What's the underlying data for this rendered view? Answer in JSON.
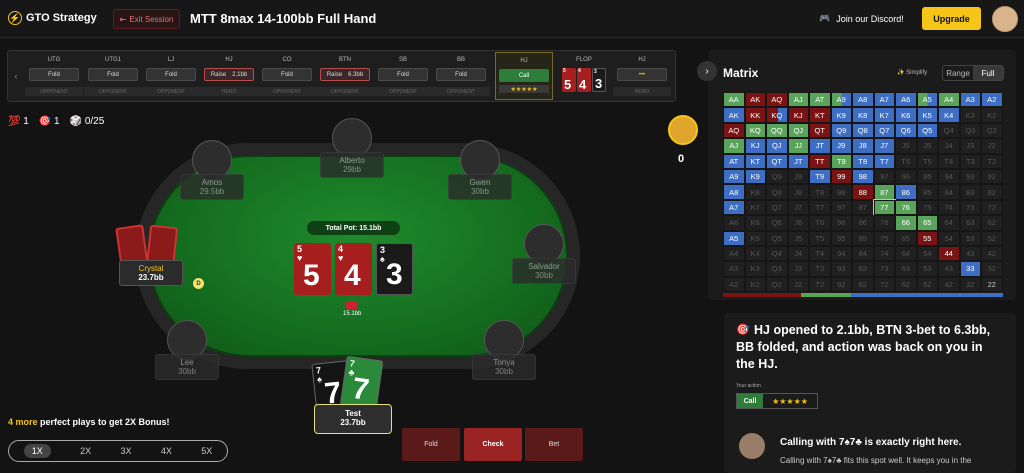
{
  "header": {
    "logo": "GTO Strategy",
    "exit": "Exit Session",
    "title": "MTT 8max 14-100bb Full Hand",
    "discord": "Join our Discord!",
    "upgrade": "Upgrade"
  },
  "strip": [
    {
      "pos": "UTG",
      "act": "Fold",
      "role": "OPPONENT"
    },
    {
      "pos": "UTG1",
      "act": "Fold",
      "role": "OPPONENT"
    },
    {
      "pos": "LJ",
      "act": "Fold",
      "role": "OPPONENT"
    },
    {
      "pos": "HJ",
      "act": "Raise",
      "amt": "2.1bb",
      "role": "HERO"
    },
    {
      "pos": "CO",
      "act": "Fold",
      "role": "OPPONENT"
    },
    {
      "pos": "BTN",
      "act": "Raise",
      "amt": "6.3bb",
      "role": "OPPONENT"
    },
    {
      "pos": "SB",
      "act": "Fold",
      "role": "OPPONENT"
    },
    {
      "pos": "BB",
      "act": "Fold",
      "role": "OPPONENT"
    },
    {
      "pos": "HJ",
      "act": "Call",
      "stars": "★★★★★"
    },
    {
      "pos": "FLOP"
    },
    {
      "pos": "HJ",
      "act": "•••",
      "role": "HERO"
    }
  ],
  "stats": {
    "s1": "💯 1",
    "s2": "🎯 1",
    "s3": "🎲 0/25"
  },
  "coin_value": "0",
  "players": {
    "amos": {
      "name": "Amos",
      "stack": "29.5bb"
    },
    "alberto": {
      "name": "Alberto",
      "stack": "29bb"
    },
    "gwen": {
      "name": "Gwen",
      "stack": "30bb"
    },
    "crystal": {
      "name": "Crystal",
      "stack": "23.7bb"
    },
    "salvador": {
      "name": "Salvador",
      "stack": "30bb"
    },
    "lee": {
      "name": "Lee",
      "stack": "30bb"
    },
    "tonya": {
      "name": "Tonya",
      "stack": "30bb"
    },
    "hero": {
      "name": "Test",
      "stack": "23.7bb"
    }
  },
  "pot": "Total Pot: 15.1bb",
  "chip_amount": "15.1bb",
  "dealer": "D",
  "board": [
    {
      "rank": "5",
      "suit": "♥",
      "color": "red"
    },
    {
      "rank": "4",
      "suit": "♥",
      "color": "red"
    },
    {
      "rank": "3",
      "suit": "♠",
      "color": "black"
    }
  ],
  "hole": [
    {
      "rank": "7",
      "suit": "♠",
      "color": "black"
    },
    {
      "rank": "7",
      "suit": "♣",
      "color": "green"
    }
  ],
  "bonus": {
    "hl": "4 more",
    "rest": " perfect plays to get 2X Bonus!"
  },
  "multipliers": [
    "1X",
    "2X",
    "3X",
    "4X",
    "5X"
  ],
  "actions": {
    "fold": "Fold",
    "check": "Check",
    "bet": "Bet"
  },
  "matrix": {
    "title": "Matrix",
    "simplify": "✨ Simplify",
    "range": "Range",
    "full": "Full",
    "rows": [
      [
        "AA",
        "AK",
        "AQ",
        "AJ",
        "AT",
        "A9",
        "A8",
        "A7",
        "A6",
        "A5",
        "A4",
        "A3",
        "A2"
      ],
      [
        "AK",
        "KK",
        "KQ",
        "KJ",
        "KT",
        "K9",
        "K8",
        "K7",
        "K6",
        "K5",
        "K4",
        "K3",
        "K2"
      ],
      [
        "AQ",
        "KQ",
        "QQ",
        "QJ",
        "QT",
        "Q9",
        "Q8",
        "Q7",
        "Q6",
        "Q5",
        "Q4",
        "Q3",
        "Q2"
      ],
      [
        "AJ",
        "KJ",
        "QJ",
        "JJ",
        "JT",
        "J9",
        "J8",
        "J7",
        "J6",
        "J5",
        "J4",
        "J3",
        "J2"
      ],
      [
        "AT",
        "KT",
        "QT",
        "JT",
        "TT",
        "T9",
        "T8",
        "T7",
        "T6",
        "T5",
        "T4",
        "T3",
        "T2"
      ],
      [
        "A9",
        "K9",
        "Q9",
        "J9",
        "T9",
        "99",
        "98",
        "97",
        "96",
        "95",
        "94",
        "93",
        "92"
      ],
      [
        "A8",
        "K8",
        "Q8",
        "J8",
        "T8",
        "98",
        "88",
        "87",
        "86",
        "85",
        "84",
        "83",
        "82"
      ],
      [
        "A7",
        "K7",
        "Q7",
        "J7",
        "T7",
        "97",
        "87",
        "77",
        "76",
        "75",
        "74",
        "73",
        "72"
      ],
      [
        "A6",
        "K6",
        "Q6",
        "J6",
        "T6",
        "96",
        "86",
        "76",
        "66",
        "65",
        "64",
        "63",
        "62"
      ],
      [
        "A5",
        "K5",
        "Q5",
        "J5",
        "T5",
        "95",
        "85",
        "75",
        "65",
        "55",
        "54",
        "53",
        "52"
      ],
      [
        "A4",
        "K4",
        "Q4",
        "J4",
        "T4",
        "94",
        "84",
        "74",
        "64",
        "54",
        "44",
        "43",
        "42"
      ],
      [
        "A3",
        "K3",
        "Q3",
        "J3",
        "T3",
        "93",
        "83",
        "73",
        "63",
        "53",
        "43",
        "33",
        "32"
      ],
      [
        "A2",
        "K2",
        "Q2",
        "J2",
        "T2",
        "92",
        "82",
        "72",
        "62",
        "52",
        "42",
        "32",
        "22"
      ]
    ],
    "colors": {
      "raise": "#7a1414",
      "call": "#5aa35a",
      "fold": "#3d6ec4"
    }
  },
  "explain": {
    "text": "HJ opened to 2.1bb, BTN 3-bet to 6.3bb, BB folded, and action was back on you in the HJ.",
    "your_action": "Your action",
    "call": "Call",
    "stars": "★★★★★",
    "coach_head": "Calling with 7♠7♣ is exactly right here.",
    "coach_body": "Calling with 7♠7♣ fits this spot well. It keeps you in the"
  }
}
